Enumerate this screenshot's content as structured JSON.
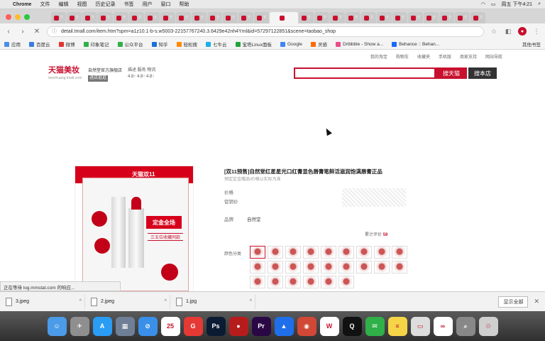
{
  "menubar": {
    "app": "Chrome",
    "menus": [
      "文件",
      "编辑",
      "视图",
      "历史记录",
      "书签",
      "用户",
      "窗口",
      "帮助"
    ],
    "clock": "周五 下午4:21"
  },
  "tabs": [
    {
      "label": "T",
      "color": "#c8102e"
    },
    {
      "label": "T",
      "color": "#c8102e"
    },
    {
      "label": "T",
      "color": "#c8102e"
    },
    {
      "label": "T",
      "color": "#c8102e"
    },
    {
      "label": "T",
      "color": "#c8102e"
    },
    {
      "label": "T",
      "color": "#c8102e"
    },
    {
      "label": "T",
      "color": "#c8102e"
    },
    {
      "label": "T",
      "color": "#c8102e"
    },
    {
      "label": "T",
      "color": "#c8102e"
    },
    {
      "label": "T",
      "color": "#c8102e"
    },
    {
      "label": "T",
      "color": "#c8102e"
    },
    {
      "label": "T",
      "color": "#c8102e"
    },
    {
      "label": "T",
      "color": "#c8102e"
    },
    {
      "label": "T",
      "color": "#c8102e"
    },
    {
      "label": "T",
      "color": "#c8102e"
    },
    {
      "label": "T",
      "color": "#c8102e"
    },
    {
      "label": "T",
      "color": "#c8102e"
    },
    {
      "label": "T",
      "color": "#c8102e"
    },
    {
      "label": "T",
      "color": "#c8102e"
    },
    {
      "label": "T",
      "color": "#c8102e"
    },
    {
      "label": "T",
      "color": "#c8102e"
    },
    {
      "label": "T",
      "color": "#c8102e"
    },
    {
      "label": "T",
      "color": "#c8102e"
    },
    {
      "label": "T",
      "color": "#c8102e"
    },
    {
      "label": "T",
      "color": "#c8102e"
    },
    {
      "label": "T",
      "color": "#c8102e"
    },
    {
      "label": "T",
      "color": "#c8102e"
    }
  ],
  "toolbar": {
    "url": "detail.tmall.com/item.htm?spm=a1z10.1-b-s.w5003-22157767240.3.6429e42nh4Yml&id=57297122851&scene=taobao_shop"
  },
  "bookmarks": {
    "items": [
      {
        "label": "应用",
        "color": "#4a8fe7"
      },
      {
        "label": "百度云",
        "color": "#3d7be0"
      },
      {
        "label": "微博",
        "color": "#e2372f"
      },
      {
        "label": "印象笔记",
        "color": "#2fb048"
      },
      {
        "label": "公众平台",
        "color": "#2fb048"
      },
      {
        "label": "知乎",
        "color": "#1a6fd8"
      },
      {
        "label": "轻松搜",
        "color": "#ff8a00"
      },
      {
        "label": "七牛云",
        "color": "#1bb0e8"
      },
      {
        "label": "宝塔Linux面板",
        "color": "#20a53a"
      },
      {
        "label": "Google",
        "color": "#4285f4"
      },
      {
        "label": "灵感",
        "color": "#ff6a00"
      },
      {
        "label": "Dribbble - Show a...",
        "color": "#ea4c89"
      },
      {
        "label": "Behance :: Behan...",
        "color": "#1769ff"
      }
    ],
    "other": "其他书签"
  },
  "page": {
    "site_links": [
      "我的淘宝",
      "购物车",
      "收藏夹",
      "手机版",
      "商家支持",
      "网站导航"
    ],
    "logo": "天猫美妆",
    "logo_sub": "meizhuang.tmall.com",
    "shop_name": "自然堂官方旗舰店",
    "shop_tag": "进店逛逛",
    "ratings": "描述  服务  物流",
    "ratings_scores": "4.8↑ 4.8↑ 4.8↑",
    "search_button": "搜天猫",
    "shop_search_button": "搜本店",
    "product": {
      "brand_badge": "天猫双11",
      "stamp": "定金全场",
      "subtitle_img": "三五位收藏同款",
      "title": "[双11预售]自然堂红星星光口红膏显色唇膏笔鲜活滋润饱满唇膏正品",
      "subtitle": "预定定金赠品/价格以实际为准",
      "label_price": "价格",
      "label_promo": "促销价",
      "label_brand": "品牌",
      "brand_value": "自然堂",
      "sales_prefix": "累计评价",
      "sales_count": "59",
      "label_color": "颜色分类"
    },
    "swatch_count": 24
  },
  "status": "正在等待 log.mmstat.com 的响应...",
  "downloads": [
    {
      "name": "3.jpeg"
    },
    {
      "name": "2.jpeg"
    },
    {
      "name": "1.jpg"
    }
  ],
  "downloads_show_all": "显示全部",
  "dock": [
    {
      "name": "finder",
      "color": "#4b9be8",
      "glyph": "☺"
    },
    {
      "name": "launchpad",
      "color": "#8f8f8f",
      "glyph": "✈"
    },
    {
      "name": "appstore",
      "color": "#2a9cf4",
      "glyph": "A"
    },
    {
      "name": "preview",
      "color": "#6f7f95",
      "glyph": "▦"
    },
    {
      "name": "safari",
      "color": "#3a8fe8",
      "glyph": "⊘"
    },
    {
      "name": "calendar",
      "color": "#ffffff",
      "glyph": "25"
    },
    {
      "name": "mail",
      "color": "#e53935",
      "glyph": "G"
    },
    {
      "name": "photoshop",
      "color": "#0b1b33",
      "glyph": "Ps"
    },
    {
      "name": "chrome-red",
      "color": "#b71c1c",
      "glyph": "●"
    },
    {
      "name": "premiere",
      "color": "#2a0845",
      "glyph": "Pr"
    },
    {
      "name": "keynote",
      "color": "#1f6feb",
      "glyph": "▲"
    },
    {
      "name": "chrome",
      "color": "#d14836",
      "glyph": "◉"
    },
    {
      "name": "wps",
      "color": "#ffffff",
      "glyph": "W"
    },
    {
      "name": "qq",
      "color": "#111111",
      "glyph": "Q"
    },
    {
      "name": "wechat",
      "color": "#2fb048",
      "glyph": "✉"
    },
    {
      "name": "stickies",
      "color": "#f5d547",
      "glyph": "≡"
    },
    {
      "name": "screens",
      "color": "#dddddd",
      "glyph": "▭"
    },
    {
      "name": "baiducloud",
      "color": "#ffffff",
      "glyph": "∞"
    },
    {
      "name": "search",
      "color": "#888888",
      "glyph": "⌕"
    },
    {
      "name": "trash",
      "color": "#cfcfcf",
      "glyph": "♲"
    }
  ]
}
